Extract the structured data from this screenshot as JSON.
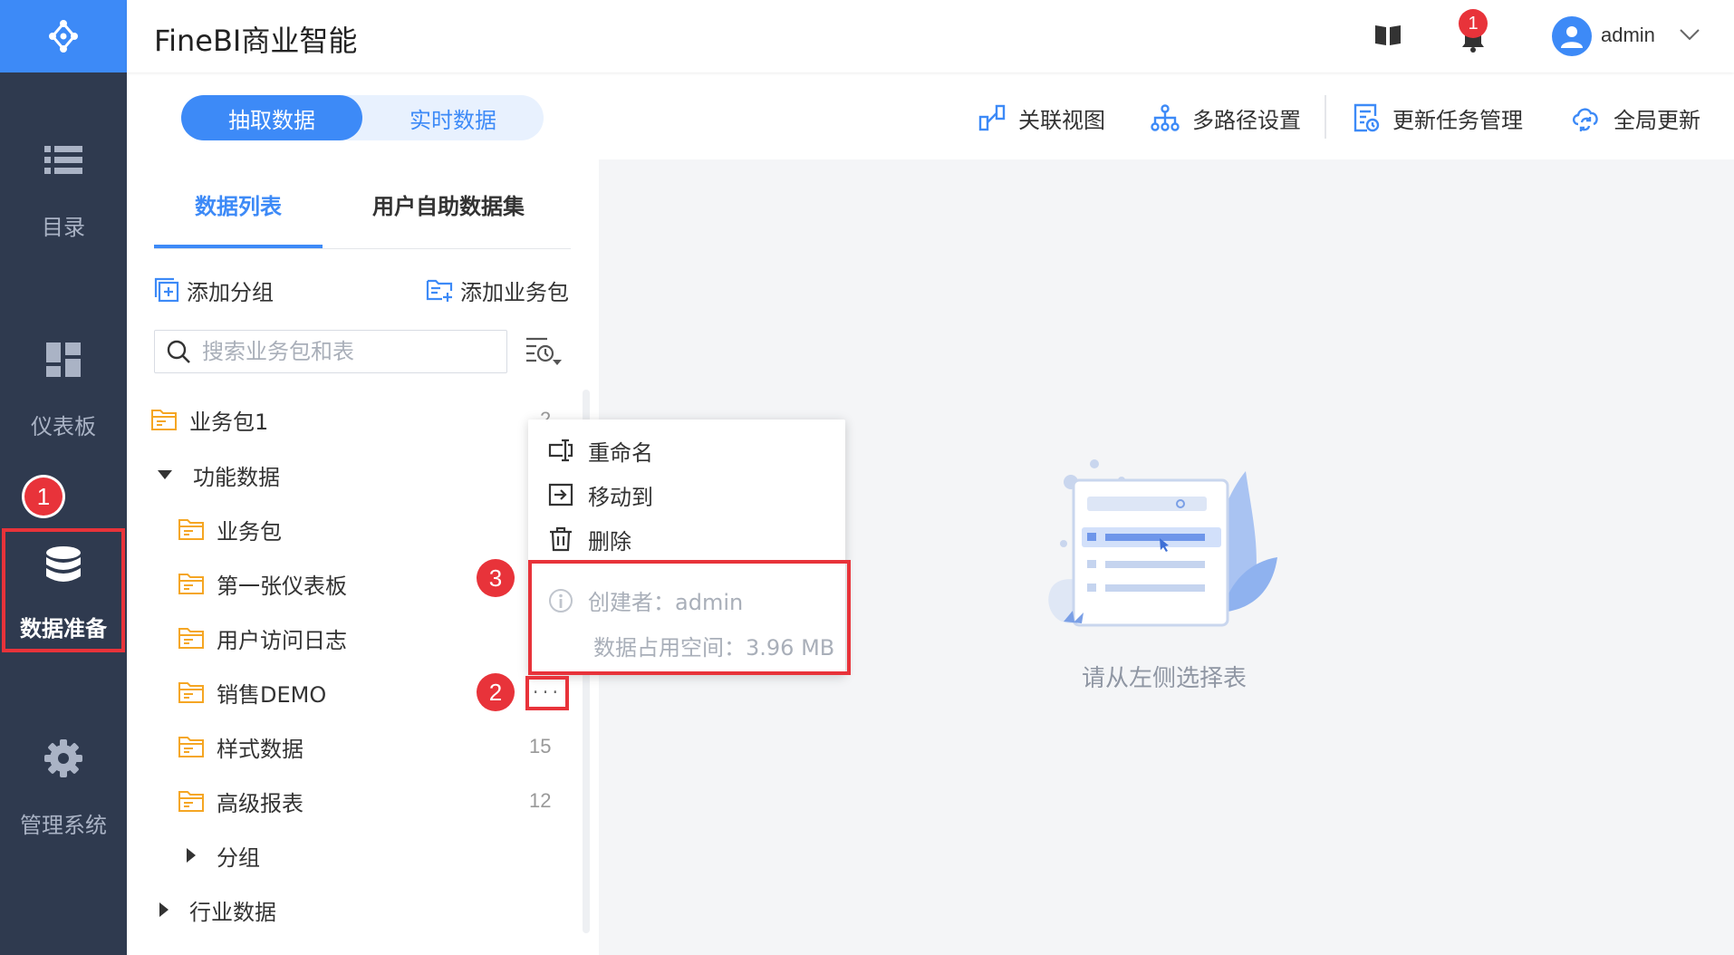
{
  "header": {
    "title": "FineBI商业智能",
    "notification_count": "1",
    "user_name": "admin"
  },
  "left_nav": {
    "items": [
      {
        "label": "目录",
        "icon": "list-icon"
      },
      {
        "label": "仪表板",
        "icon": "dashboard-grid-icon"
      },
      {
        "label": "数据准备",
        "icon": "database-icon",
        "active": true
      },
      {
        "label": "管理系统",
        "icon": "gear-icon"
      }
    ]
  },
  "toolbar": {
    "modes": [
      "抽取数据",
      "实时数据"
    ],
    "actions": [
      "关联视图",
      "多路径设置",
      "更新任务管理",
      "全局更新"
    ]
  },
  "panel": {
    "tabs": [
      "数据列表",
      "用户自助数据集"
    ],
    "add_group": "添加分组",
    "add_package": "添加业务包",
    "search_placeholder": "搜索业务包和表",
    "tree": [
      {
        "label": "业务包1",
        "count": "2"
      },
      {
        "label": "功能数据"
      },
      {
        "label": "业务包"
      },
      {
        "label": "第一张仪表板"
      },
      {
        "label": "用户访问日志"
      },
      {
        "label": "销售DEMO",
        "more": "···"
      },
      {
        "label": "样式数据",
        "count": "15"
      },
      {
        "label": "高级报表",
        "count": "12"
      },
      {
        "label": "分组"
      },
      {
        "label": "行业数据"
      }
    ]
  },
  "context_menu": {
    "rename": "重命名",
    "move_to": "移动到",
    "delete": "删除",
    "creator": "创建者：admin",
    "space": "数据占用空间：3.96 MB"
  },
  "empty_state": {
    "text": "请从左侧选择表"
  },
  "annotations": [
    "1",
    "2",
    "3"
  ],
  "colors": {
    "primary": "#3d8af7",
    "nav_bg": "#2f3a4f",
    "annotation_red": "#e8333a",
    "folder": "#f5a623"
  }
}
